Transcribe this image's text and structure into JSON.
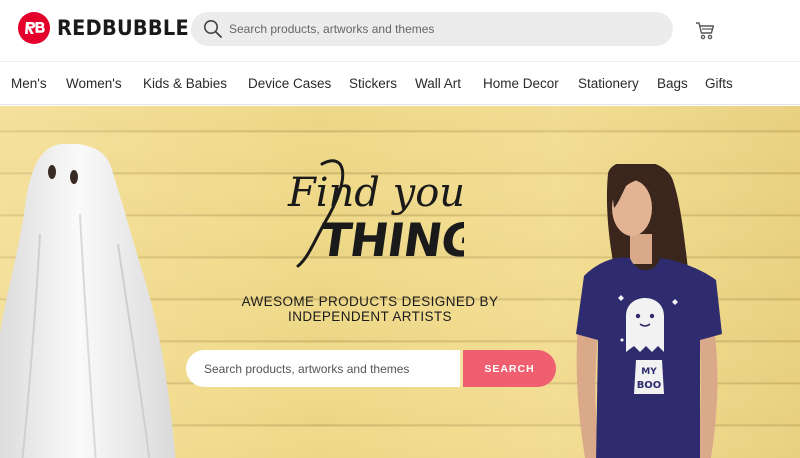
{
  "header": {
    "logo_text": "REDBUBBLE",
    "search_placeholder": "Search products, artworks and themes"
  },
  "nav": {
    "items": [
      "Men's",
      "Women's",
      "Kids & Babies",
      "Device Cases",
      "Stickers",
      "Wall Art",
      "Home Decor",
      "Stationery",
      "Bags",
      "Gifts"
    ]
  },
  "hero": {
    "tagline_line1": "Find your",
    "tagline_line2": "THING",
    "subtitle_line1": "AWESOME PRODUCTS DESIGNED BY",
    "subtitle_line2": "INDEPENDENT ARTISTS",
    "search_placeholder": "Search products, artworks and themes",
    "search_button": "SEARCH",
    "shirt_text_line1": "MY",
    "shirt_text_line2": "BOO"
  },
  "colors": {
    "brand": "#e4002b",
    "search_button": "#ef5f6f",
    "wall": "#efd98a",
    "shirt": "#2e2b6e"
  }
}
